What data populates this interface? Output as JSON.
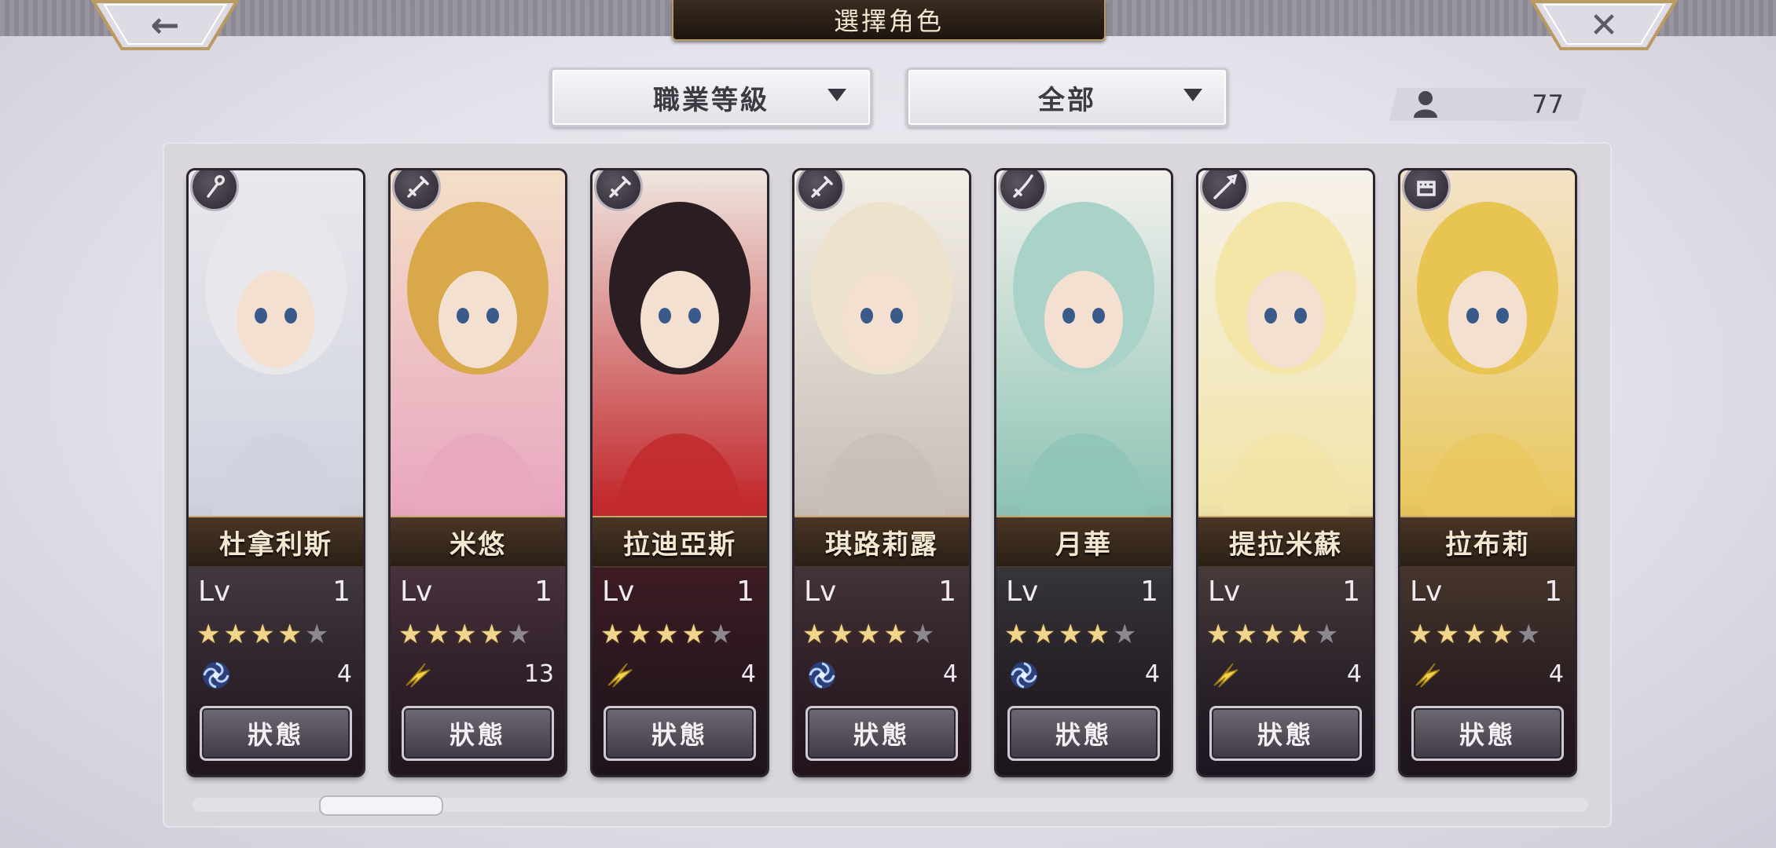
{
  "header": {
    "title": "選擇角色",
    "back_icon": "←",
    "close_icon": "✕"
  },
  "filters": {
    "class_level": "職業等級",
    "category": "全部"
  },
  "roster_count": "77",
  "status_label": "狀態",
  "level_label": "Lv",
  "colors": {
    "star_on": "#f2d58c",
    "star_off": "#8c8892",
    "name_band": "#3a2a1d"
  },
  "characters": [
    {
      "name": "杜拿利斯",
      "level": "1",
      "stars": 4,
      "element": "wind-swirl",
      "count": "4",
      "class": "staff"
    },
    {
      "name": "米悠",
      "level": "1",
      "stars": 4,
      "element": "lightning-wing",
      "count": "13",
      "class": "sword"
    },
    {
      "name": "拉迪亞斯",
      "level": "1",
      "stars": 4,
      "element": "lightning-wing",
      "count": "4",
      "class": "sword"
    },
    {
      "name": "琪路莉露",
      "level": "1",
      "stars": 4,
      "element": "wind-swirl",
      "count": "4",
      "class": "sword"
    },
    {
      "name": "月華",
      "level": "1",
      "stars": 4,
      "element": "wind-swirl",
      "count": "4",
      "class": "katana"
    },
    {
      "name": "提拉米蘇",
      "level": "1",
      "stars": 4,
      "element": "lightning-wing",
      "count": "4",
      "class": "spear"
    },
    {
      "name": "拉布莉",
      "level": "1",
      "stars": 4,
      "element": "lightning-wing",
      "count": "4",
      "class": "fist"
    }
  ]
}
